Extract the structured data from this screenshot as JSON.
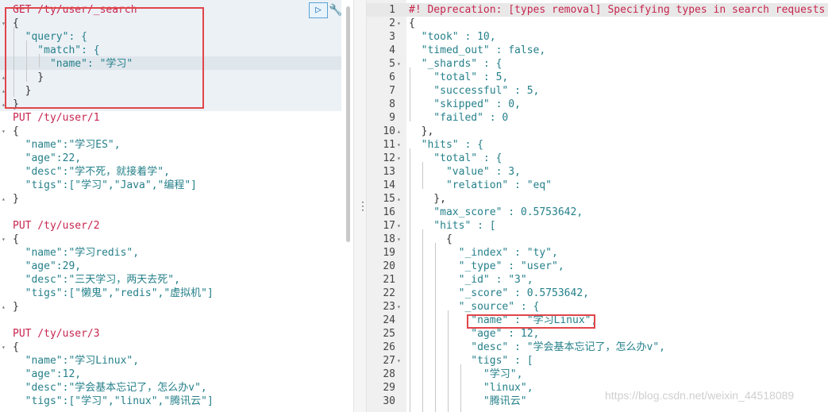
{
  "request_editor": {
    "run_button_icon": "play-icon",
    "settings_button_icon": "wrench-icon",
    "lines": [
      {
        "text": "GET /ty/user/_search",
        "kind": "method"
      },
      {
        "text": "{",
        "kind": "punct"
      },
      {
        "text": "  \"query\": {",
        "kind": "json"
      },
      {
        "text": "    \"match\": {",
        "kind": "json"
      },
      {
        "text": "      \"name\": \"学习\"",
        "kind": "json"
      },
      {
        "text": "    }",
        "kind": "punct"
      },
      {
        "text": "  }",
        "kind": "punct"
      },
      {
        "text": "}",
        "kind": "punct"
      },
      {
        "text": "PUT /ty/user/1",
        "kind": "method"
      },
      {
        "text": "{",
        "kind": "punct"
      },
      {
        "text": "  \"name\":\"学习ES\",",
        "kind": "json"
      },
      {
        "text": "  \"age\":22,",
        "kind": "json"
      },
      {
        "text": "  \"desc\":\"学不死，就接着学\",",
        "kind": "json"
      },
      {
        "text": "  \"tigs\":[\"学习\",\"Java\",\"编程\"]",
        "kind": "json"
      },
      {
        "text": "}",
        "kind": "punct"
      },
      {
        "text": "",
        "kind": "blank"
      },
      {
        "text": "PUT /ty/user/2",
        "kind": "method"
      },
      {
        "text": "{",
        "kind": "punct"
      },
      {
        "text": "  \"name\":\"学习redis\",",
        "kind": "json"
      },
      {
        "text": "  \"age\":29,",
        "kind": "json"
      },
      {
        "text": "  \"desc\":\"三天学习，两天去死\",",
        "kind": "json"
      },
      {
        "text": "  \"tigs\":[\"懒鬼\",\"redis\",\"虚拟机\"]",
        "kind": "json"
      },
      {
        "text": "}",
        "kind": "punct"
      },
      {
        "text": "",
        "kind": "blank"
      },
      {
        "text": "PUT /ty/user/3",
        "kind": "method"
      },
      {
        "text": "{",
        "kind": "punct"
      },
      {
        "text": "  \"name\":\"学习Linux\",",
        "kind": "json"
      },
      {
        "text": "  \"age\":12,",
        "kind": "json"
      },
      {
        "text": "  \"desc\":\"学会基本忘记了，怎么办v\",",
        "kind": "json"
      },
      {
        "text": "  \"tigs\":[\"学习\",\"linux\",\"腾讯云\"]",
        "kind": "json"
      }
    ]
  },
  "response_viewer": {
    "lines": [
      {
        "no": "1",
        "text": "#! Deprecation: [types removal] Specifying types in search requests is",
        "kind": "comment"
      },
      {
        "no": "2",
        "text": "{",
        "kind": "punct"
      },
      {
        "no": "3",
        "text": "  \"took\" : 10,",
        "kind": "json"
      },
      {
        "no": "4",
        "text": "  \"timed_out\" : false,",
        "kind": "json"
      },
      {
        "no": "5",
        "text": "  \"_shards\" : {",
        "kind": "json"
      },
      {
        "no": "6",
        "text": "    \"total\" : 5,",
        "kind": "json"
      },
      {
        "no": "7",
        "text": "    \"successful\" : 5,",
        "kind": "json"
      },
      {
        "no": "8",
        "text": "    \"skipped\" : 0,",
        "kind": "json"
      },
      {
        "no": "9",
        "text": "    \"failed\" : 0",
        "kind": "json"
      },
      {
        "no": "10",
        "text": "  },",
        "kind": "punct"
      },
      {
        "no": "11",
        "text": "  \"hits\" : {",
        "kind": "json"
      },
      {
        "no": "12",
        "text": "    \"total\" : {",
        "kind": "json"
      },
      {
        "no": "13",
        "text": "      \"value\" : 3,",
        "kind": "json"
      },
      {
        "no": "14",
        "text": "      \"relation\" : \"eq\"",
        "kind": "json"
      },
      {
        "no": "15",
        "text": "    },",
        "kind": "punct"
      },
      {
        "no": "16",
        "text": "    \"max_score\" : 0.5753642,",
        "kind": "json"
      },
      {
        "no": "17",
        "text": "    \"hits\" : [",
        "kind": "json"
      },
      {
        "no": "18",
        "text": "      {",
        "kind": "punct"
      },
      {
        "no": "19",
        "text": "        \"_index\" : \"ty\",",
        "kind": "json"
      },
      {
        "no": "20",
        "text": "        \"_type\" : \"user\",",
        "kind": "json"
      },
      {
        "no": "21",
        "text": "        \"_id\" : \"3\",",
        "kind": "json"
      },
      {
        "no": "22",
        "text": "        \"_score\" : 0.5753642,",
        "kind": "json"
      },
      {
        "no": "23",
        "text": "        \"_source\" : {",
        "kind": "json"
      },
      {
        "no": "24",
        "text": "          \"name\" : \"学习Linux\",",
        "kind": "json"
      },
      {
        "no": "25",
        "text": "          \"age\" : 12,",
        "kind": "json"
      },
      {
        "no": "26",
        "text": "          \"desc\" : \"学会基本忘记了，怎么办v\",",
        "kind": "json"
      },
      {
        "no": "27",
        "text": "          \"tigs\" : [",
        "kind": "json"
      },
      {
        "no": "28",
        "text": "            \"学习\",",
        "kind": "json"
      },
      {
        "no": "29",
        "text": "            \"linux\",",
        "kind": "json"
      },
      {
        "no": "30",
        "text": "            \"腾讯云\"",
        "kind": "json"
      }
    ]
  },
  "watermark": "https://blog.csdn.net/weixin_44518089",
  "colors": {
    "highlight_box": "#e0454a",
    "method": "#c7254e",
    "json_key": "#25808a",
    "number": "#1a6fb0",
    "boolean": "#3455d6"
  }
}
